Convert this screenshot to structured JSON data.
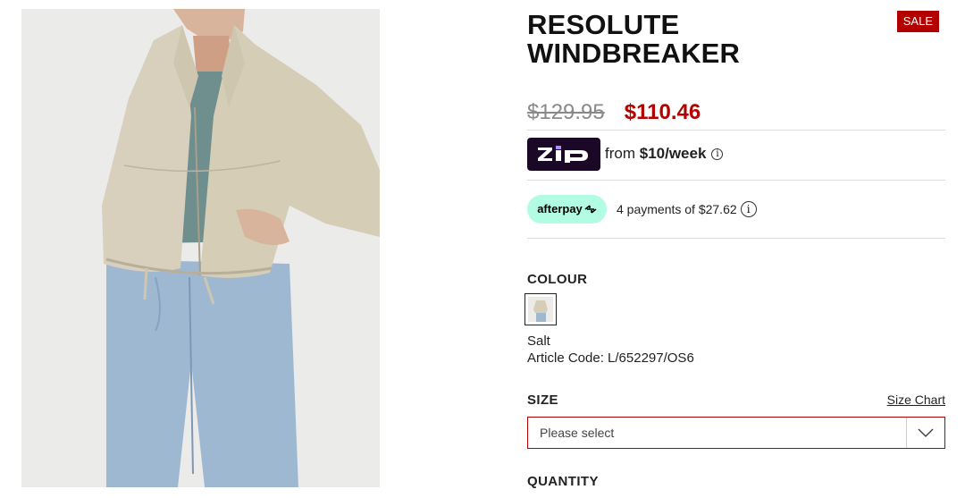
{
  "product": {
    "image_alt": "Model wearing a beige cropped windbreaker with light blue jeans",
    "title_line1": "RESOLUTE",
    "title_line2": "WINDBREAKER",
    "badge": "SALE",
    "price_original": "$129.95",
    "price_sale": "$110.46"
  },
  "zip": {
    "logo_text": "zip",
    "prefix": "from ",
    "amount": "$10/week",
    "info": "i"
  },
  "afterpay": {
    "logo_text": "afterpay",
    "text": "4 payments of $27.62",
    "info": "i",
    "brand_color": "#b2fce4"
  },
  "colour": {
    "label": "COLOUR",
    "selected_name": "Salt",
    "article_code": "Article Code: L/652297/OS6"
  },
  "size": {
    "label": "SIZE",
    "chart_link": "Size Chart",
    "placeholder": "Please select"
  },
  "quantity": {
    "label": "QUANTITY"
  },
  "colors": {
    "sale_red": "#b30000",
    "zip_dark": "#1a0826",
    "zip_accent": "#aa8fff"
  }
}
